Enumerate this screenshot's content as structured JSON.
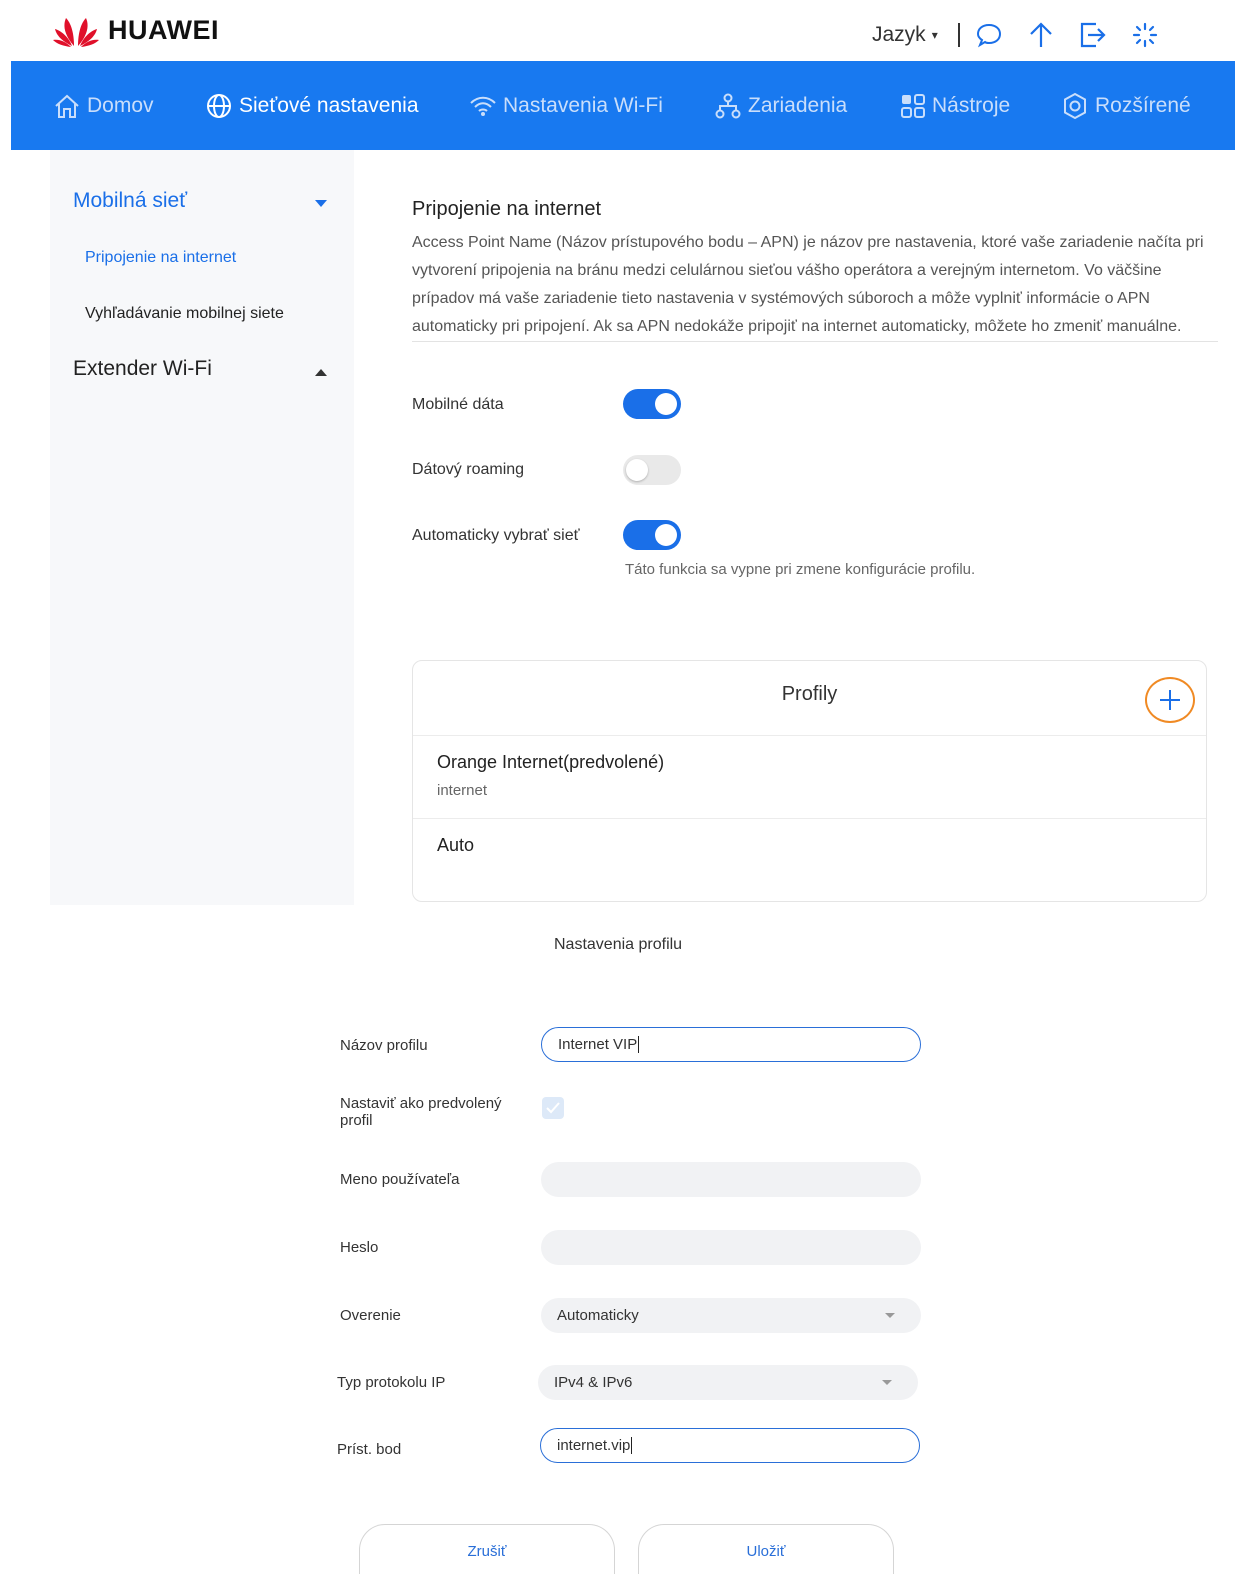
{
  "brand": {
    "name": "HUAWEI",
    "logo_color": "#e0102a"
  },
  "header": {
    "language_label": "Jazyk",
    "icons": [
      "chat-icon",
      "upload-arrow-icon",
      "logout-icon",
      "loading-spinner-icon"
    ]
  },
  "nav": {
    "items": [
      {
        "label": "Domov",
        "icon": "home-icon",
        "active": false
      },
      {
        "label": "Sieťové nastavenia",
        "icon": "globe-icon",
        "active": true
      },
      {
        "label": "Nastavenia Wi-Fi",
        "icon": "wifi-icon",
        "active": false
      },
      {
        "label": "Zariadenia",
        "icon": "devices-icon",
        "active": false
      },
      {
        "label": "Nástroje",
        "icon": "tools-icon",
        "active": false
      },
      {
        "label": "Rozšírené",
        "icon": "gear-icon",
        "active": false
      }
    ],
    "bar_color": "#1879f0"
  },
  "sidebar": {
    "groups": [
      {
        "label": "Mobilná sieť",
        "expanded": true,
        "items": [
          {
            "label": "Pripojenie na internet",
            "active": true
          },
          {
            "label": "Vyhľadávanie mobilnej siete",
            "active": false
          }
        ]
      },
      {
        "label": "Extender Wi-Fi",
        "expanded": false,
        "items": []
      }
    ]
  },
  "main": {
    "title": "Pripojenie na internet",
    "description": "Access Point Name (Názov prístupového bodu – APN) je názov pre nastavenia, ktoré vaše zariadenie načíta pri vytvorení pripojenia na bránu medzi celulárnou sieťou vášho operátora a verejným internetom. Vo väčšine prípadov má vaše zariadenie tieto nastavenia v systémových súboroch a môže vyplniť informácie o APN automaticky pri pripojení. Ak sa APN nedokáže pripojiť na internet automaticky, môžete ho zmeniť manuálne.",
    "toggles": [
      {
        "label": "Mobilné dáta",
        "on": true
      },
      {
        "label": "Dátový roaming",
        "on": false
      },
      {
        "label": "Automaticky vybrať sieť",
        "on": true
      }
    ],
    "auto_select_hint": "Táto funkcia sa vypne pri zmene konfigurácie profilu."
  },
  "profiles": {
    "title": "Profily",
    "items": [
      {
        "name": "Orange Internet(predvolené)",
        "apn": "internet"
      },
      {
        "name": "Auto",
        "apn": ""
      }
    ]
  },
  "profile_form": {
    "title": "Nastavenia profilu",
    "profile_name_label": "Názov profilu",
    "profile_name_value": "Internet VIP",
    "default_label": "Nastaviť ako predvolený profil",
    "default_checked": true,
    "username_label": "Meno používateľa",
    "username_value": "",
    "password_label": "Heslo",
    "password_value": "",
    "auth_label": "Overenie",
    "auth_value": "Automaticky",
    "ip_type_label": "Typ protokolu IP",
    "ip_type_value": "IPv4 & IPv6",
    "apn_label": "Príst. bod",
    "apn_value": "internet.vip",
    "cancel_label": "Zrušiť",
    "save_label": "Uložiť"
  },
  "colors": {
    "accent": "#1a6fe8",
    "highlight": "#f08a24",
    "link": "#2a6fd8"
  }
}
